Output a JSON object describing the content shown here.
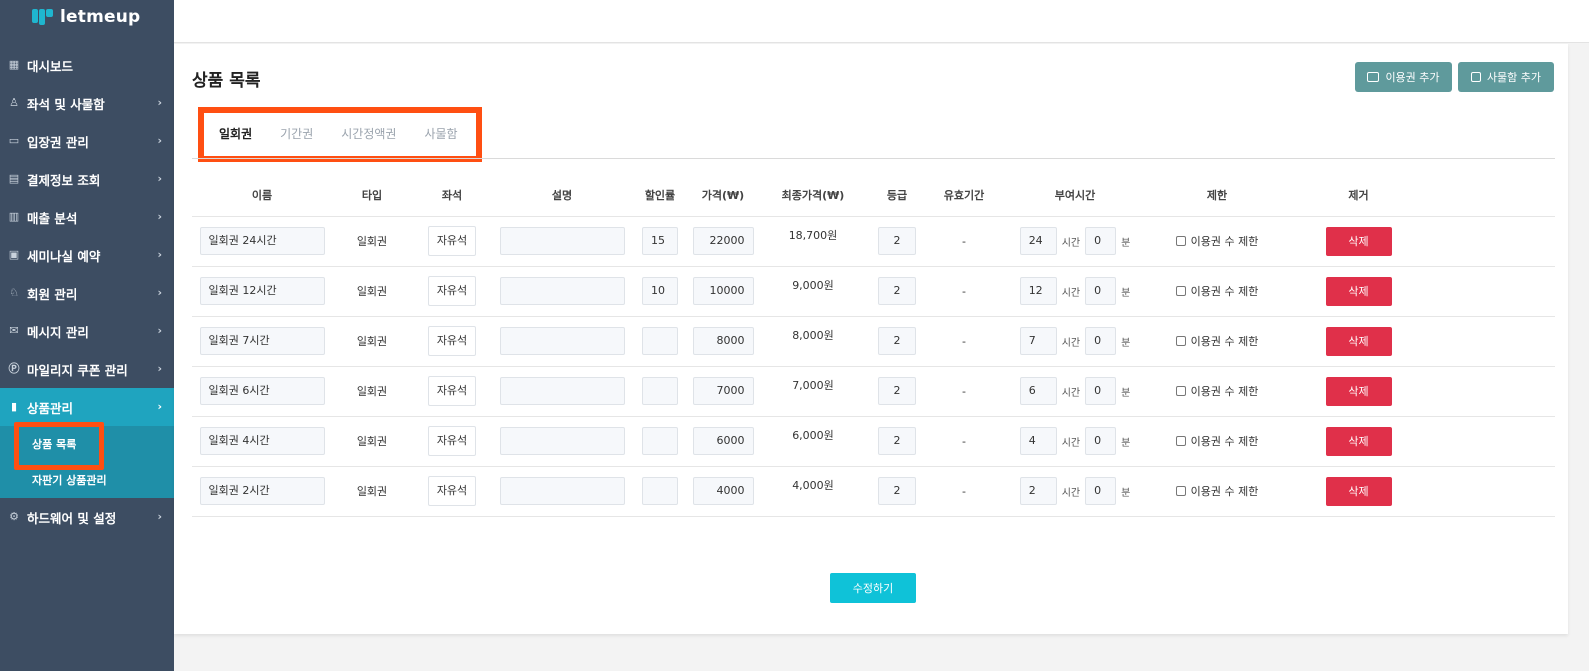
{
  "brand": {
    "name": "letmeup"
  },
  "sidebar": {
    "items": [
      {
        "label": "대시보드",
        "icon": "grid-icon"
      },
      {
        "label": "좌석 및 사물함",
        "icon": "seat-icon"
      },
      {
        "label": "입장권 관리",
        "icon": "ticket-icon"
      },
      {
        "label": "결제정보 조회",
        "icon": "card-icon"
      },
      {
        "label": "매출 분석",
        "icon": "bar-chart-icon"
      },
      {
        "label": "세미나실 예약",
        "icon": "calendar-icon"
      },
      {
        "label": "회원 관리",
        "icon": "users-icon"
      },
      {
        "label": "메시지 관리",
        "icon": "mail-icon"
      },
      {
        "label": "마일리지 쿠폰 관리",
        "icon": "coin-icon"
      },
      {
        "label": "상품관리",
        "icon": "bag-icon"
      },
      {
        "label": "하드웨어 및 설정",
        "icon": "gear-icon"
      }
    ],
    "sub_items": [
      "상품 목록",
      "자판기 상품관리"
    ]
  },
  "page": {
    "title": "상품 목록",
    "add_pass_label": "이용권 추가",
    "add_locker_label": "사물함 추가",
    "tabs": [
      "일회권",
      "기간권",
      "시간정액권",
      "사물함"
    ],
    "save_label": "수정하기"
  },
  "table": {
    "headers": [
      "이름",
      "타입",
      "좌석",
      "설명",
      "할인률",
      "가격(₩)",
      "최종가격(₩)",
      "등급",
      "유효기간",
      "부여시간",
      "제한",
      "제거"
    ],
    "hour_unit": "시간",
    "minute_unit": "분",
    "limit_label": "이용권 수 제한",
    "delete_label": "삭제",
    "rows": [
      {
        "name": "일회권 24시간",
        "type": "일회권",
        "seat": "자유석",
        "desc": "",
        "discount": "15",
        "price": "22000",
        "final": "18,700원",
        "grade": "2",
        "validity": "-",
        "hours": "24",
        "minutes": "0"
      },
      {
        "name": "일회권 12시간",
        "type": "일회권",
        "seat": "자유석",
        "desc": "",
        "discount": "10",
        "price": "10000",
        "final": "9,000원",
        "grade": "2",
        "validity": "-",
        "hours": "12",
        "minutes": "0"
      },
      {
        "name": "일회권 7시간",
        "type": "일회권",
        "seat": "자유석",
        "desc": "",
        "discount": "",
        "price": "8000",
        "final": "8,000원",
        "grade": "2",
        "validity": "-",
        "hours": "7",
        "minutes": "0"
      },
      {
        "name": "일회권 6시간",
        "type": "일회권",
        "seat": "자유석",
        "desc": "",
        "discount": "",
        "price": "7000",
        "final": "7,000원",
        "grade": "2",
        "validity": "-",
        "hours": "6",
        "minutes": "0"
      },
      {
        "name": "일회권 4시간",
        "type": "일회권",
        "seat": "자유석",
        "desc": "",
        "discount": "",
        "price": "6000",
        "final": "6,000원",
        "grade": "2",
        "validity": "-",
        "hours": "4",
        "minutes": "0"
      },
      {
        "name": "일회권 2시간",
        "type": "일회권",
        "seat": "자유석",
        "desc": "",
        "discount": "",
        "price": "4000",
        "final": "4,000원",
        "grade": "2",
        "validity": "-",
        "hours": "2",
        "minutes": "0"
      }
    ]
  },
  "colors": {
    "sidebar": "#3d4d62",
    "active": "#1fa4bf",
    "highlight": "#ff4f12",
    "delete": "#e0304a",
    "save": "#0fc2d8",
    "top_button": "#5f9a9c"
  }
}
